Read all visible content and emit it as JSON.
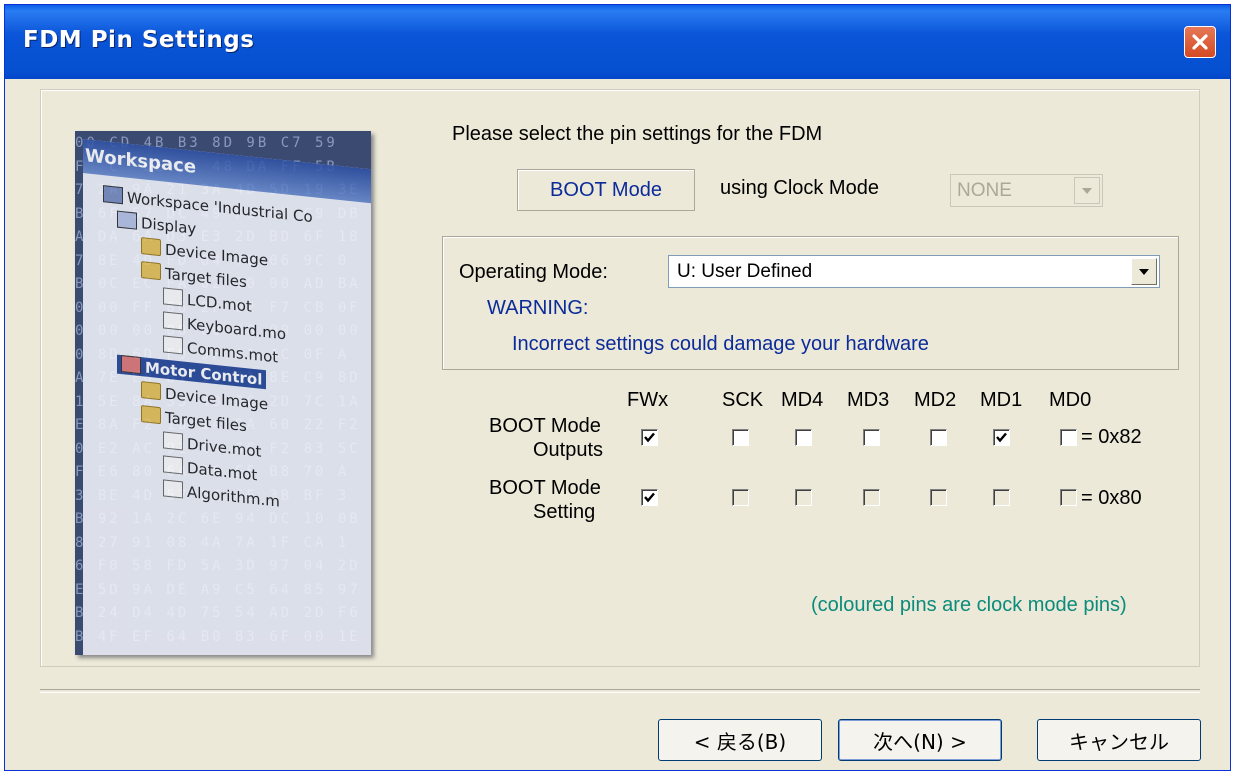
{
  "window": {
    "title": "FDM Pin Settings"
  },
  "illustration": {
    "panel_title": "Workspace",
    "hex_lines": [
      "00 CD 4B B3 8D 9B C7 59",
      "F  C  DE B1 48 DA FF 5B",
      "7 2A 9A 21 3A 4D 5D 19 3E",
      "B 6F 57 DC 49 F5 67 C9 DB",
      "A DA 6A D3 E3 2D BD 6F 18",
      "7 8E 4D FD 04 70 06 9C 0",
      "B 0C EC FA 02 00 00 AD BA",
      "0 00 FF 86 2F 02 F7 CB 0F",
      "0 00 00 00 00 00 00 00 00",
      "0 8D 6D F9 9F A1 4C 0F A",
      "A 7E E8 B1 11 41 8E C9 8D",
      "1 5E 8A 33 4B 6C 2D 7C 1A",
      "E 8A F2 18 14 DA 60 22 F2",
      "0 E2 AC 91 4A 6C F2 83 5C",
      "F E6 80 6A 56 E5 B8 70 A",
      "3 BE 4D 57 BC CE 3B BF 3",
      "B 92 1A 2C 6E 94 DC 10 0B",
      "8 27 91 08 4A 7A 1F CA 1",
      "6 F0 58 FD 5A 3D 97 04 2D",
      "E 5D 9A DE A9 C5 64 85 97",
      "B 24 D4 4D 75 54 AD 2D F6",
      "B 4F EF 64 B0 83 6F 00 1E"
    ],
    "tree": [
      {
        "label": "Workspace 'Industrial Co",
        "icon": "ws-icon"
      },
      {
        "label": "Display",
        "icon": "project-icon"
      },
      {
        "label": "Device Image",
        "icon": "folder-icon"
      },
      {
        "label": "Target files",
        "icon": "folder-icon"
      },
      {
        "label": "LCD.mot",
        "icon": "file-icon"
      },
      {
        "label": "Keyboard.mo",
        "icon": "file-icon"
      },
      {
        "label": "Comms.mot",
        "icon": "file-icon"
      },
      {
        "label": "Motor Control",
        "icon": "project-icon"
      },
      {
        "label": "Device Image",
        "icon": "folder-icon"
      },
      {
        "label": "Target files",
        "icon": "folder-icon"
      },
      {
        "label": "Drive.mot",
        "icon": "file-icon"
      },
      {
        "label": "Data.mot",
        "icon": "file-icon"
      },
      {
        "label": "Algorithm.m",
        "icon": "file-icon"
      }
    ]
  },
  "instructions": "Please select the pin settings for the FDM",
  "boot_mode": "BOOT Mode",
  "clock_mode_label": "using Clock Mode",
  "clock_mode_value": "NONE",
  "operating_mode": {
    "label": "Operating Mode:",
    "value": "U: User Defined",
    "warning_title": "WARNING:",
    "warning_text": "Incorrect settings could damage your hardware"
  },
  "pins": {
    "headers": [
      "FWx",
      "SCK",
      "MD4",
      "MD3",
      "MD2",
      "MD1",
      "MD0"
    ],
    "rows": [
      {
        "label_line1": "BOOT Mode",
        "label_line2": "Outputs",
        "checked": [
          true,
          false,
          false,
          false,
          false,
          true,
          false
        ],
        "value": "= 0x82"
      },
      {
        "label_line1": "BOOT Mode",
        "label_line2": "Setting",
        "checked": [
          true,
          false,
          false,
          false,
          false,
          false,
          false
        ],
        "value": "= 0x80"
      }
    ]
  },
  "note": "(coloured pins are clock mode pins)",
  "buttons": {
    "back": "< 戻る(B)",
    "next": "次へ(N) >",
    "cancel": "キャンセル"
  }
}
